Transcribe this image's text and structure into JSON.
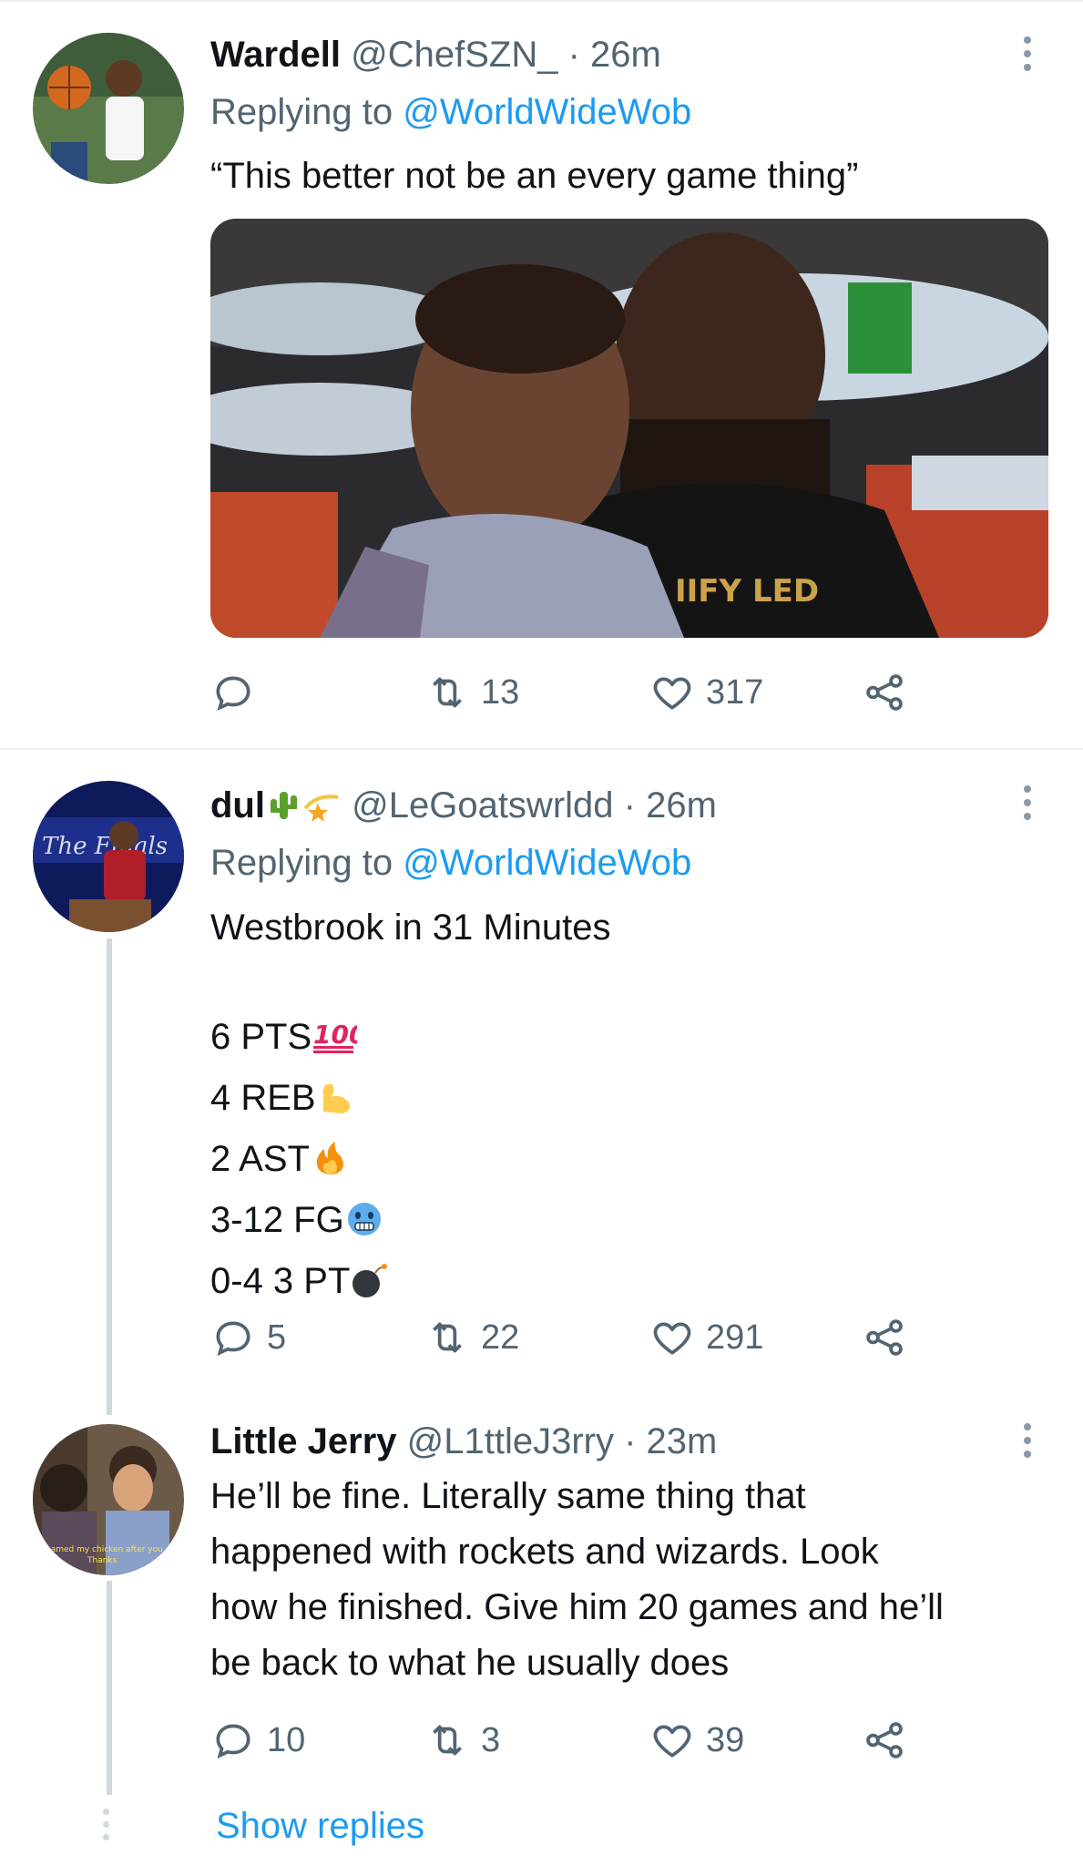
{
  "tweets": [
    {
      "name": "Wardell",
      "handle": "@ChefSZN_",
      "time": "· 26m",
      "replying_prefix": "Replying to ",
      "replying_to": "@WorldWideWob",
      "text": "“This better not be an every game thing”",
      "actions": {
        "reply": "",
        "retweet": "13",
        "like": "317"
      }
    },
    {
      "name": "dul",
      "handle": "@LeGoatswrldd",
      "time": "· 26m",
      "replying_prefix": "Replying to ",
      "replying_to": "@WorldWideWob",
      "text_line1": "Westbrook in 31 Minutes",
      "stats": [
        "6 PTS",
        "4 REB",
        "2 AST",
        "3-12 FG",
        "0-4 3 PT"
      ],
      "stat_emojis": [
        "hundred-points-emoji",
        "flexed-biceps-emoji",
        "fire-emoji",
        "cold-face-emoji",
        "bomb-emoji"
      ],
      "actions": {
        "reply": "5",
        "retweet": "22",
        "like": "291"
      }
    },
    {
      "name": "Little Jerry",
      "handle": "@L1ttleJ3rry",
      "time": "· 23m",
      "text": "He’ll be fine. Literally same thing that\nhappened with rockets and wizards. Look\nhow he finished. Give him 20 games and he’ll\nbe back to what he usually does",
      "actions": {
        "reply": "10",
        "retweet": "3",
        "like": "39"
      }
    }
  ],
  "show_replies": "Show replies",
  "colors": {
    "link": "#1d9bf0",
    "secondary": "#536471",
    "text": "#0f1419"
  }
}
